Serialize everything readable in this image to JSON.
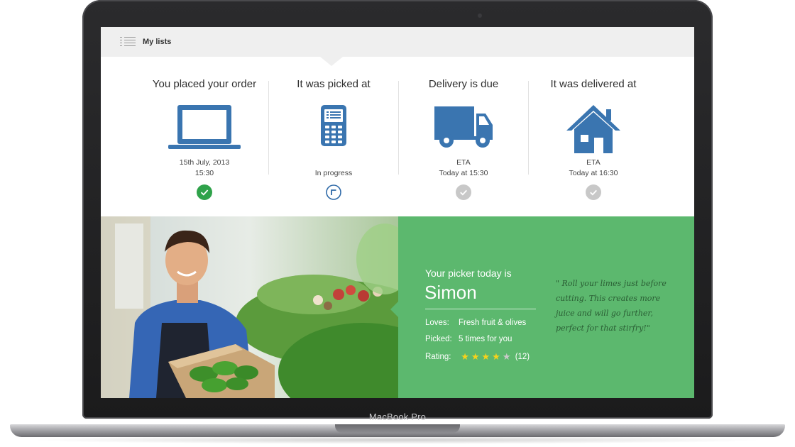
{
  "device": {
    "label": "MacBook Pro"
  },
  "topbar": {
    "title": "My lists",
    "icon": "list-menu-icon"
  },
  "steps": [
    {
      "title": "You placed your order",
      "icon": "laptop-icon",
      "line1": "15th July, 2013",
      "line2": "15:30",
      "status": "complete"
    },
    {
      "title": "It was picked at",
      "icon": "handheld-scanner-icon",
      "line1": "",
      "line2": "In progress",
      "status": "in-progress"
    },
    {
      "title": "Delivery is due",
      "icon": "delivery-truck-icon",
      "line1": "ETA",
      "line2": "Today at 15:30",
      "status": "pending"
    },
    {
      "title": "It was delivered at",
      "icon": "house-icon",
      "line1": "ETA",
      "line2": "Today at 16:30",
      "status": "pending"
    }
  ],
  "picker": {
    "intro": "Your picker today is",
    "name": "Simon",
    "loves_label": "Loves:",
    "loves_value": "Fresh fruit & olives",
    "picked_label": "Picked:",
    "picked_value": "5 times for you",
    "rating_label": "Rating:",
    "rating_value": 4,
    "rating_max": 5,
    "rating_count": "(12)",
    "quote": "\" Roll your limes just before cutting. This creates more juice and will go further, perfect for that stirfry!\""
  },
  "colors": {
    "accent_blue": "#3a75b0",
    "complete_green": "#2fa24a",
    "pending_grey": "#c8c8c8",
    "panel_green": "#5cb86e",
    "star_yellow": "#f7d21a"
  }
}
